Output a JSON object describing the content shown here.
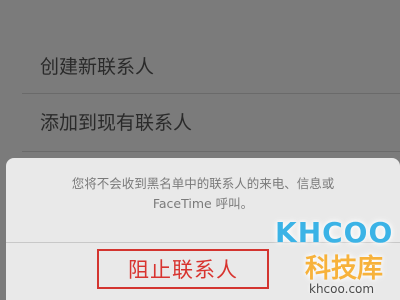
{
  "menu": {
    "items": [
      {
        "label": "创建新联系人"
      },
      {
        "label": "添加到现有联系人"
      }
    ]
  },
  "sheet": {
    "message_line1": "您将不会收到黑名单中的联系人的来电、信息或",
    "message_line2": "FaceTime 呼叫。",
    "block_label": "阻止联系人"
  },
  "watermark": {
    "brand": "KHCOO",
    "cn_name": "科技库",
    "url": "khcoo.com"
  },
  "colors": {
    "overlay_bg": "#7b7b7b",
    "sheet_bg": "#e9e9e9",
    "destructive_red": "#d8342f",
    "highlight_border": "#d3342f"
  }
}
